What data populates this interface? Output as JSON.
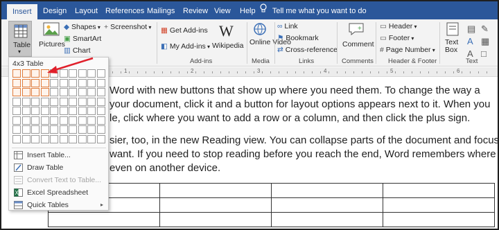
{
  "tabs": [
    "Insert",
    "Design",
    "Layout",
    "References",
    "Mailings",
    "Review",
    "View",
    "Help"
  ],
  "tell_me": "Tell me what you want to do",
  "ribbon": {
    "table_label": "Table",
    "pictures_label": "Pictures",
    "shapes_label": "Shapes",
    "smartart_label": "SmartArt",
    "chart_label": "Chart",
    "screenshot_label": "Screenshot",
    "get_addins_label": "Get Add-ins",
    "my_addins_label": "My Add-ins",
    "wikipedia_label": "Wikipedia",
    "addins_group": "Add-ins",
    "online_video_label": "Online Video",
    "media_group": "Media",
    "link_label": "Link",
    "bookmark_label": "Bookmark",
    "crossref_label": "Cross-reference",
    "links_group": "Links",
    "comment_label": "Comment",
    "comments_group": "Comments",
    "header_label": "Header",
    "footer_label": "Footer",
    "pagenumber_label": "Page Number",
    "hf_group": "Header & Footer",
    "textbox_label": "Text Box",
    "text_group": "Text"
  },
  "dropdown": {
    "title": "4x3 Table",
    "grid_cols": 10,
    "grid_rows": 8,
    "selected_cols": 4,
    "selected_rows": 3,
    "items": [
      {
        "label": "Insert Table...",
        "disabled": false
      },
      {
        "label": "Draw Table",
        "disabled": false
      },
      {
        "label": "Convert Text to Table...",
        "disabled": true
      },
      {
        "label": "Excel Spreadsheet",
        "disabled": false
      },
      {
        "label": "Quick Tables",
        "disabled": false
      }
    ]
  },
  "document": {
    "lines": [
      "Word with new buttons that show up where you need them. To change the way a",
      "your document, click it and a button for layout options appears next to it. When you",
      "le, click where you want to add a row or a column, and then click the plus sign.",
      "sier, too, in the new Reading view. You can collapse parts of the document and focus on",
      "want. If you need to stop reading before you reach the end, Word remembers where",
      "even on another device."
    ]
  },
  "ruler_numbers": [
    "1",
    "2",
    "3",
    "4",
    "5",
    "6"
  ],
  "colors": {
    "brand": "#2b579a",
    "selection": "#e07b3a",
    "arrow": "#e0202b"
  }
}
